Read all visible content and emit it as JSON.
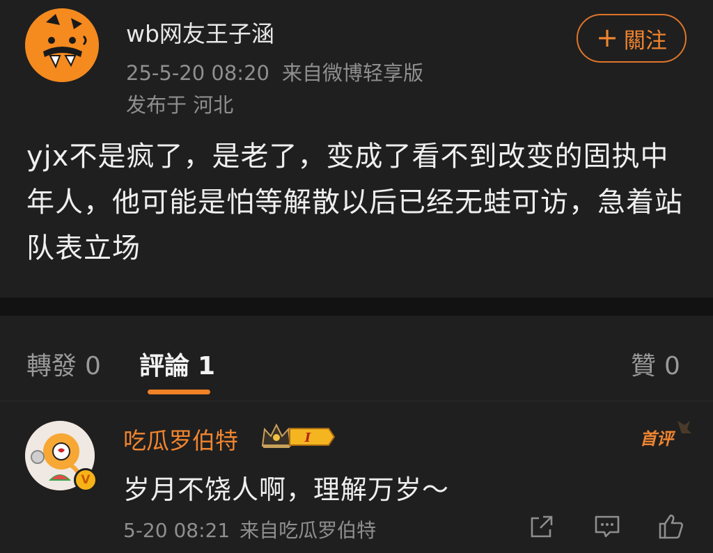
{
  "post": {
    "author_name": "wb网友王子涵",
    "timestamp": "25-5-20 08:20",
    "source": "来自微博轻享版",
    "location": "发布于 河北",
    "follow_label": "關注",
    "body": "yjx不是疯了，是老了，变成了看不到改变的固执中年人，他可能是怕等解散以后已经无蛙可访，急着站队表立场"
  },
  "tabs": {
    "repost_label": "轉發",
    "repost_count": "0",
    "comment_label": "評論",
    "comment_count": "1",
    "like_label": "贊",
    "like_count": "0"
  },
  "comment": {
    "author_name": "吃瓜罗伯特",
    "level": "I",
    "first_comment_label": "首评",
    "text": "岁月不饶人啊，理解万岁～",
    "timestamp": "5-20 08:21",
    "source": "来自吃瓜罗伯特",
    "verified_mark": "V"
  },
  "colors": {
    "accent": "#f08530",
    "background": "#1f1f1f",
    "separator": "#121212",
    "meta_text": "#8f8f8f"
  }
}
